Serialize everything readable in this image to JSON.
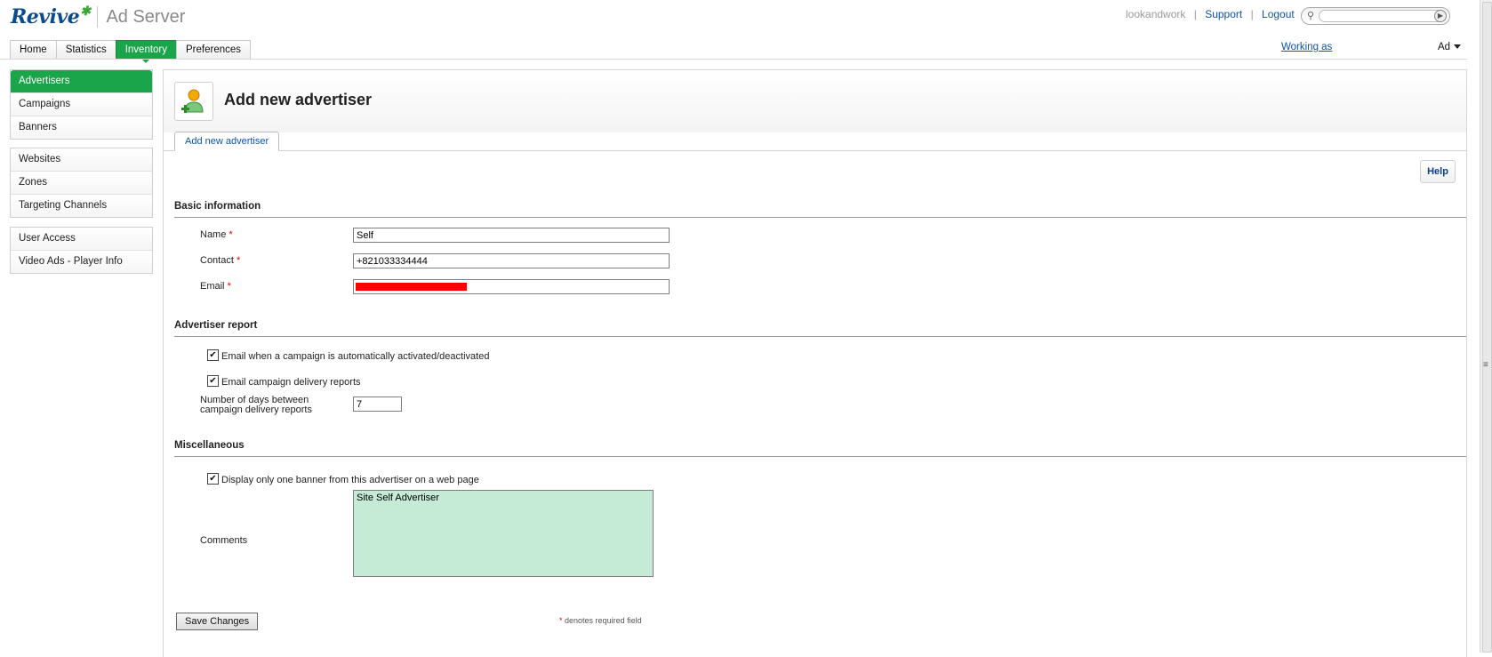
{
  "header": {
    "brand": "Revive",
    "product": "Ad Server",
    "user": "lookandwork",
    "links": [
      "Support",
      "Logout"
    ],
    "search_placeholder": ""
  },
  "tabs": [
    {
      "label": "Home",
      "active": false
    },
    {
      "label": "Statistics",
      "active": false
    },
    {
      "label": "Inventory",
      "active": true
    },
    {
      "label": "Preferences",
      "active": false
    }
  ],
  "working_as": "Working as",
  "account_select": "Ad",
  "sidebar": {
    "group1": [
      "Advertisers",
      "Campaigns",
      "Banners"
    ],
    "group2": [
      "Websites",
      "Zones",
      "Targeting Channels"
    ],
    "group3": [
      "User Access",
      "Video Ads - Player Info"
    ]
  },
  "page": {
    "title": "Add new advertiser",
    "subtab": "Add new advertiser",
    "help": "Help"
  },
  "basic": {
    "title": "Basic information",
    "name_label": "Name",
    "name_value": "Self",
    "contact_label": "Contact",
    "contact_value": "+821033334444",
    "email_label": "Email",
    "required_mark": "*"
  },
  "report": {
    "title": "Advertiser report",
    "check1": "Email when a campaign is automatically activated/deactivated",
    "check2": "Email campaign delivery reports",
    "days_label_line1": "Number of days between",
    "days_label_line2": "campaign delivery reports",
    "days_value": "7"
  },
  "misc": {
    "title": "Miscellaneous",
    "check3": "Display only one banner from this advertiser on a web page",
    "comments_label": "Comments",
    "comments_value": "Site Self Advertiser"
  },
  "footer": {
    "save": "Save Changes",
    "req_star": "*",
    "req_note": "denotes required field"
  },
  "colors": {
    "accent_green": "#1aa54a",
    "link_blue": "#0b55a8",
    "comments_bg": "#c5ead6",
    "redaction": "#ff0000"
  }
}
